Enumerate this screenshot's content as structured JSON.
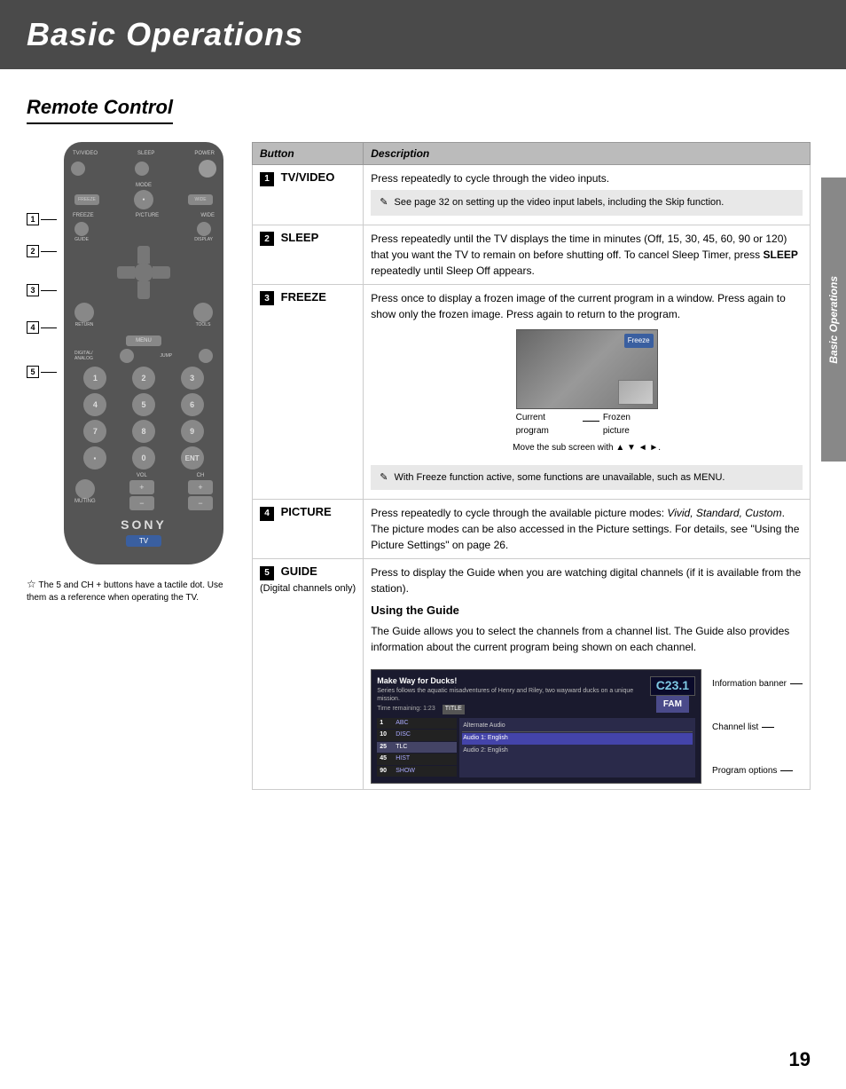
{
  "header": {
    "title": "Basic Operations",
    "background": "#4a4a4a"
  },
  "side_label": "Basic Operations",
  "page_number": "19",
  "section": {
    "title": "Remote Control"
  },
  "remote": {
    "labels": {
      "tv_video": "TV/VIDEO",
      "sleep": "SLEEP",
      "power": "POWER",
      "mode": "MODE",
      "freeze": "FREEZE",
      "picture": "P/CTURE",
      "wide": "WIDE",
      "guide": "GUIDE",
      "display": "DISPLAY",
      "return": "RETURN",
      "tools": "TOOLS",
      "menu": "MENU",
      "digital_analog": "DIGITAL/ANALOG",
      "jump": "JUMP",
      "muting": "MUTING",
      "vol": "VOL",
      "ch": "CH",
      "sony": "SONY",
      "tv": "TV"
    },
    "note": "The 5 and CH + buttons have a tactile dot. Use them as a reference when operating the TV."
  },
  "table": {
    "headers": {
      "button": "Button",
      "description": "Description"
    },
    "rows": [
      {
        "number": "1",
        "button": "TV/VIDEO",
        "description": "Press repeatedly to cycle through the video inputs.",
        "note": "See page 32 on setting up the video input labels, including the Skip function."
      },
      {
        "number": "2",
        "button": "SLEEP",
        "description": "Press repeatedly until the TV displays the time in minutes (Off, 15, 30, 45, 60, 90 or 120) that you want the TV to remain on before shutting off. To cancel Sleep Timer, press SLEEP repeatedly until Sleep Off appears."
      },
      {
        "number": "3",
        "button": "FREEZE",
        "description": "Press once to display a frozen image of the current program in a window. Press again to show only the frozen image. Press again to return to the program.",
        "freeze_labels": {
          "current": "Current program",
          "frozen": "Frozen picture",
          "freeze_badge": "Freeze",
          "move_text": "Move the sub screen with ▲ ▼ ◄ ►."
        },
        "note": "With Freeze function active, some functions are unavailable, such as MENU."
      },
      {
        "number": "4",
        "button": "PICTURE",
        "description": "Press repeatedly to cycle through the available picture modes: Vivid, Standard, Custom. The picture modes can be also accessed in the Picture settings. For details, see \"Using the Picture Settings\" on page 26."
      },
      {
        "number": "5",
        "button": "GUIDE",
        "button_sub": "(Digital channels only)",
        "description": "Press to display the Guide when you are watching digital channels (if it is available from the station).",
        "guide_section": {
          "title": "Using the Guide",
          "body": "The Guide allows you to select the channels from a channel list. The Guide also provides information about the current program being shown on each channel.",
          "screenshot": {
            "program_title": "Make Way for Ducks!",
            "program_info": "Series follows the aquatic misadventures of Henry and Riley, two wayward ducks on a unique mission.",
            "time_remaining": "Time remaining: 1:23",
            "channel_badge": "C23.1",
            "channel_name": "FAM",
            "channels": [
              {
                "num": "1",
                "name": "ABC"
              },
              {
                "num": "10",
                "name": "DISC"
              },
              {
                "num": "25",
                "name": "TLC",
                "highlighted": true
              },
              {
                "num": "45",
                "name": "HIST"
              },
              {
                "num": "90",
                "name": "SHOW"
              }
            ],
            "options": [
              "Alternate Audio",
              "Audio 1: English",
              "Audio 2: English"
            ]
          },
          "labels": {
            "information_banner": "Information banner",
            "channel_list": "Channel list",
            "program_options": "Program options"
          }
        }
      }
    ]
  }
}
